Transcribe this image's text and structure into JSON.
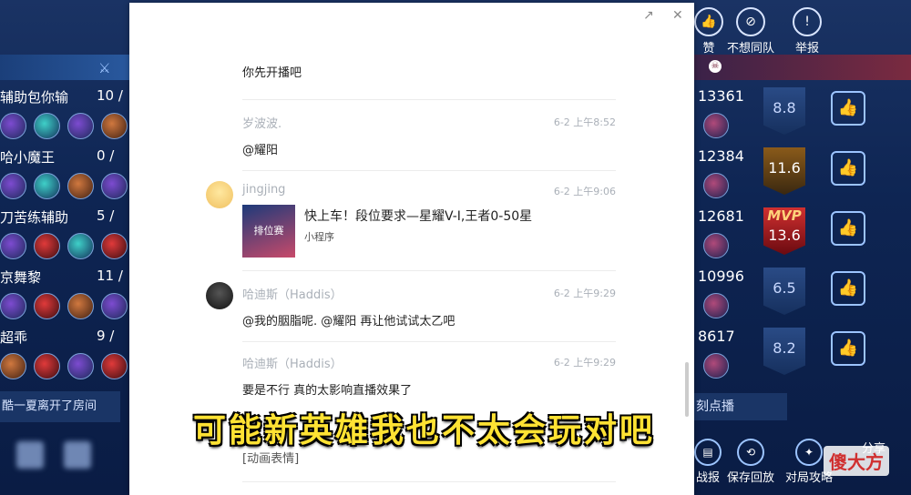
{
  "left_scoreboard": {
    "players": [
      {
        "name": "辅助包你输",
        "kills": "10 /"
      },
      {
        "name": "哈小魔王",
        "kills": "0 /"
      },
      {
        "name": "刀苦练辅助",
        "kills": "5 /"
      },
      {
        "name": "京舞黎",
        "kills": "11 /"
      },
      {
        "name": "超乖",
        "kills": "9 /"
      }
    ],
    "room_text": "酷一夏离开了房间"
  },
  "right_scoreboard": {
    "top_actions": [
      {
        "label": "赞",
        "icon": "thumb-icon"
      },
      {
        "label": "不想同队",
        "icon": "no-team-icon"
      },
      {
        "label": "举报",
        "icon": "report-icon"
      }
    ],
    "players": [
      {
        "score": "13361",
        "rating": "8.8",
        "badge": ""
      },
      {
        "score": "12384",
        "rating": "11.6",
        "badge": "gold"
      },
      {
        "score": "12681",
        "rating": "13.6",
        "badge": "MVP"
      },
      {
        "score": "10996",
        "rating": "6.5",
        "badge": ""
      },
      {
        "score": "8617",
        "rating": "8.2",
        "badge": ""
      }
    ],
    "broadcast_label": "刻点播",
    "bottom_actions": [
      "战报",
      "保存回放",
      "对局攻略",
      "分享"
    ]
  },
  "chat": {
    "messages": [
      {
        "sender": "",
        "time": "",
        "text": "你先开播吧"
      },
      {
        "sender": "岁波波.",
        "time": "6-2 上午8:52",
        "text": "@耀阳"
      },
      {
        "sender": "jingjing",
        "time": "6-2 上午9:06",
        "text": ""
      },
      {
        "sender": "哈迪斯（Haddis）",
        "time": "6-2 上午9:29",
        "text": "@我的胭脂呢. @耀阳 再让他试试太乙吧"
      },
      {
        "sender": "哈迪斯（Haddis）",
        "time": "6-2 上午9:29",
        "text": "要是不行 真的太影响直播效果了"
      }
    ],
    "mini_program": {
      "title": "快上车！段位要求—星耀V-I,王者0-50星",
      "type": "小程序",
      "thumb_text": "排位赛"
    },
    "last_message": "[动画表情]"
  },
  "subtitle": "可能新英雄我也不太会玩对吧",
  "watermark": "傻大方"
}
